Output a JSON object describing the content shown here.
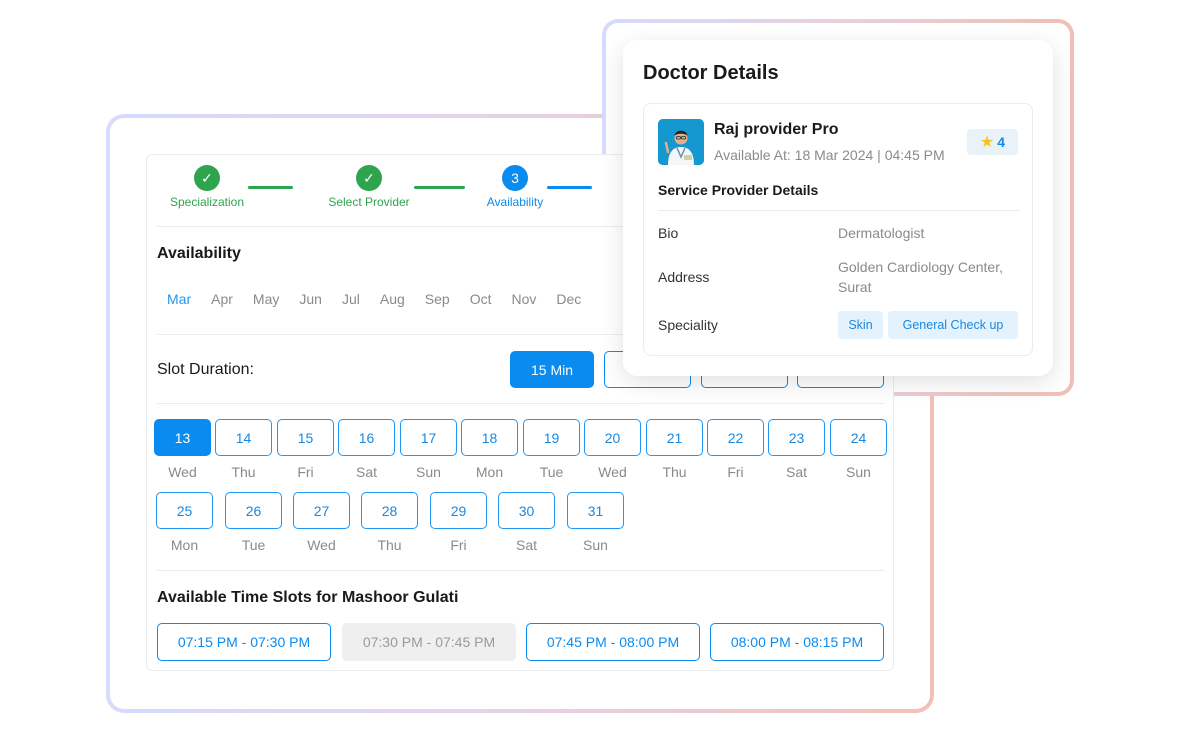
{
  "stepper": {
    "steps": [
      {
        "label": "Specialization",
        "state": "done",
        "marker": "✓"
      },
      {
        "label": "Select Provider",
        "state": "done",
        "marker": "✓"
      },
      {
        "label": "Availability",
        "state": "active",
        "marker": "3"
      }
    ]
  },
  "availability": {
    "title": "Availability",
    "months": [
      "Mar",
      "Apr",
      "May",
      "Jun",
      "Jul",
      "Aug",
      "Sep",
      "Oct",
      "Nov",
      "Dec"
    ],
    "selected_month": "Mar"
  },
  "slot_duration": {
    "label": "Slot Duration:",
    "options": [
      "15 Min",
      "",
      "",
      ""
    ],
    "selected": "15 Min"
  },
  "dates": {
    "selected": "13",
    "items": [
      {
        "date": "13",
        "day": "Wed"
      },
      {
        "date": "14",
        "day": "Thu"
      },
      {
        "date": "15",
        "day": "Fri"
      },
      {
        "date": "16",
        "day": "Sat"
      },
      {
        "date": "17",
        "day": "Sun"
      },
      {
        "date": "18",
        "day": "Mon"
      },
      {
        "date": "19",
        "day": "Tue"
      },
      {
        "date": "20",
        "day": "Wed"
      },
      {
        "date": "21",
        "day": "Thu"
      },
      {
        "date": "22",
        "day": "Fri"
      },
      {
        "date": "23",
        "day": "Sat"
      },
      {
        "date": "24",
        "day": "Sun"
      },
      {
        "date": "25",
        "day": "Mon"
      },
      {
        "date": "26",
        "day": "Tue"
      },
      {
        "date": "27",
        "day": "Wed"
      },
      {
        "date": "28",
        "day": "Thu"
      },
      {
        "date": "29",
        "day": "Fri"
      },
      {
        "date": "30",
        "day": "Sat"
      },
      {
        "date": "31",
        "day": "Sun"
      }
    ]
  },
  "time_slots": {
    "title": "Available Time Slots for Mashoor Gulati",
    "slots": [
      {
        "label": "07:15 PM - 07:30 PM",
        "disabled": false
      },
      {
        "label": "07:30 PM - 07:45 PM",
        "disabled": true
      },
      {
        "label": "07:45 PM - 08:00 PM",
        "disabled": false
      },
      {
        "label": "08:00 PM - 08:15 PM",
        "disabled": false
      }
    ]
  },
  "doctor": {
    "title": "Doctor Details",
    "name": "Raj provider Pro",
    "available_at": "Available At: 18 Mar 2024 | 04:45 PM",
    "rating": "4",
    "rating_icon": "star-icon",
    "section_title": "Service Provider Details",
    "bio_label": "Bio",
    "bio_value": "Dermatologist",
    "address_label": "Address",
    "address_line1": "Golden Cardiology Center,",
    "address_line2": "Surat",
    "speciality_label": "Speciality",
    "specialities": [
      "Skin",
      "General Check up"
    ]
  },
  "colors": {
    "primary": "#0a8bf0",
    "success": "#2ea44f",
    "muted": "#8a8a8a",
    "disabled_bg": "#efefef"
  }
}
